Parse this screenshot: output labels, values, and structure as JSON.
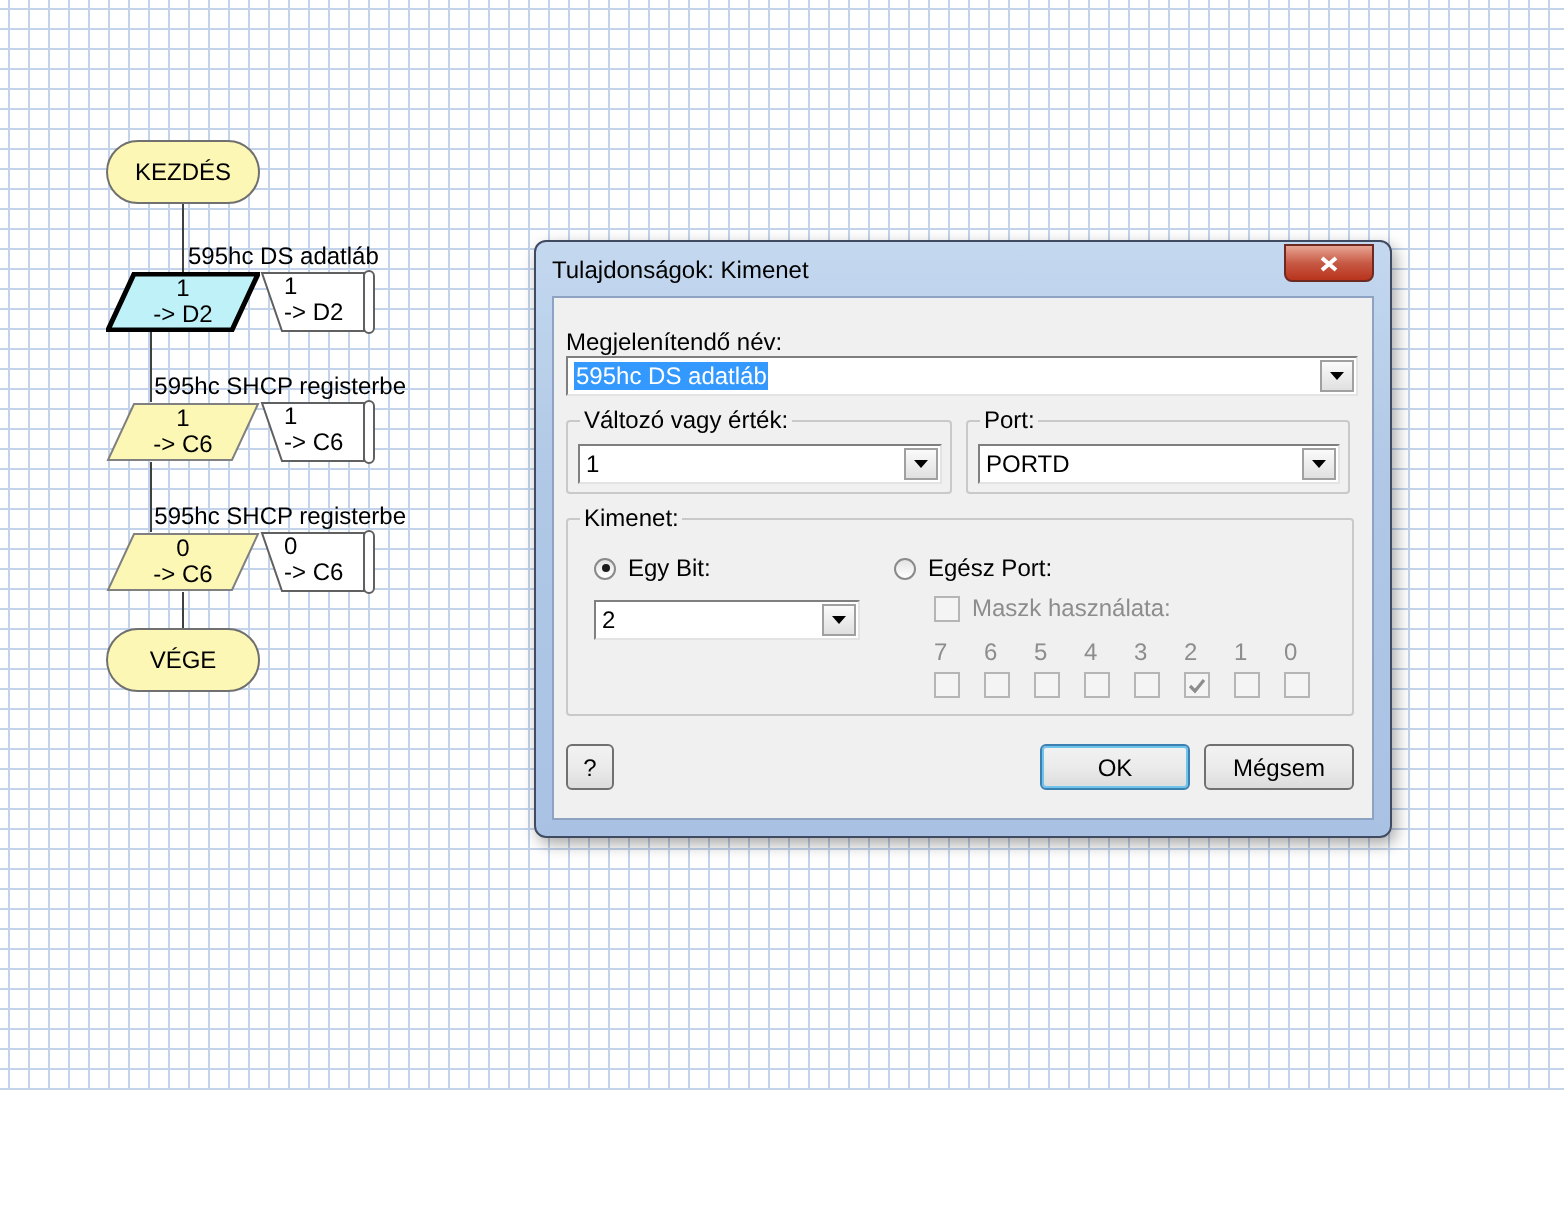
{
  "flowchart": {
    "nodes": [
      {
        "kind": "terminator",
        "text": "KEZDÉS"
      },
      {
        "kind": "output",
        "label": "595hc DS adatláb",
        "value": "1",
        "target": "-> D2",
        "selected": true,
        "comment": [
          "1",
          "-> D2"
        ]
      },
      {
        "kind": "output",
        "label": "595hc SHCP registerbe",
        "value": "1",
        "target": "-> C6",
        "selected": false,
        "comment": [
          "1",
          "-> C6"
        ]
      },
      {
        "kind": "output",
        "label": "595hc SHCP registerbe",
        "value": "0",
        "target": "-> C6",
        "selected": false,
        "comment": [
          "0",
          "-> C6"
        ]
      },
      {
        "kind": "terminator",
        "text": "VÉGE"
      }
    ]
  },
  "dialog": {
    "title": "Tulajdonságok: Kimenet",
    "display_name": {
      "label": "Megjelenítendő név:",
      "value": "595hc DS adatláb",
      "text_selected": true
    },
    "variable": {
      "label": "Változó vagy érték:",
      "value": "1"
    },
    "port": {
      "label": "Port:",
      "value": "PORTD"
    },
    "output_group": {
      "label": "Kimenet:",
      "options": [
        {
          "label": "Egy Bit:",
          "selected": true
        },
        {
          "label": "Egész Port:",
          "selected": false
        }
      ],
      "bit": {
        "value": "2"
      },
      "mask": {
        "label": "Maszk használata:",
        "checked": false,
        "disabled": true
      },
      "bits": [
        {
          "label": "7",
          "checked": false
        },
        {
          "label": "6",
          "checked": false
        },
        {
          "label": "5",
          "checked": false
        },
        {
          "label": "4",
          "checked": false
        },
        {
          "label": "3",
          "checked": false
        },
        {
          "label": "2",
          "checked": true
        },
        {
          "label": "1",
          "checked": false
        },
        {
          "label": "0",
          "checked": false
        }
      ]
    },
    "buttons": [
      {
        "kind": "help",
        "label": "?"
      },
      {
        "kind": "ok",
        "label": "OK"
      },
      {
        "kind": "cancel",
        "label": "Mégsem"
      }
    ]
  }
}
